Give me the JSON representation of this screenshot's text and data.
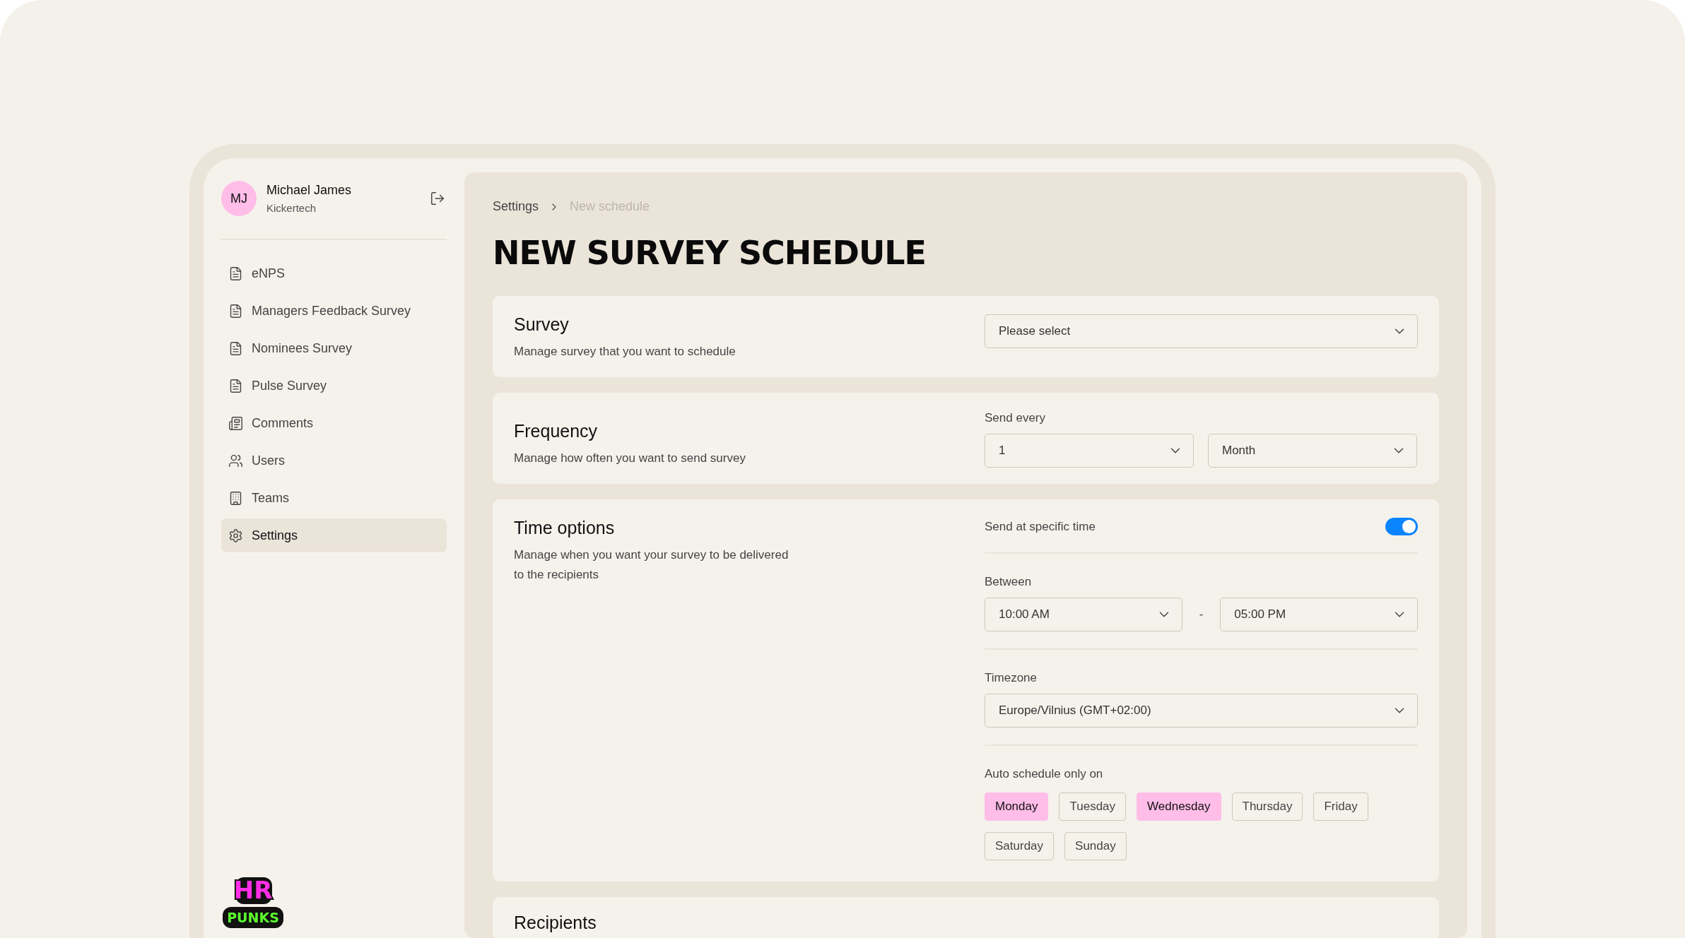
{
  "user": {
    "initials": "MJ",
    "name": "Michael James",
    "company": "Kickertech"
  },
  "nav": [
    {
      "label": "eNPS",
      "kind": "survey",
      "selected": false
    },
    {
      "label": "Managers Feedback Survey",
      "kind": "survey",
      "selected": false
    },
    {
      "label": "Nominees Survey",
      "kind": "survey",
      "selected": false
    },
    {
      "label": "Pulse Survey",
      "kind": "survey",
      "selected": false
    },
    {
      "label": "Comments",
      "kind": "comments",
      "selected": false
    },
    {
      "label": "Users",
      "kind": "users",
      "selected": false
    },
    {
      "label": "Teams",
      "kind": "teams",
      "selected": false
    },
    {
      "label": "Settings",
      "kind": "settings",
      "selected": true
    }
  ],
  "logo": {
    "line_1": "HR",
    "line_2": "PUNKS"
  },
  "breadcrumb": [
    {
      "label": "Settings",
      "current": false
    },
    {
      "label": "New schedule",
      "current": true
    }
  ],
  "title": "NEW SURVEY SCHEDULE",
  "survey_section": {
    "title": "Survey",
    "description": "Manage survey that you want to schedule",
    "select": {
      "placeholder": "Please select"
    }
  },
  "frequency_section": {
    "title": "Frequency",
    "description": "Manage how often you want to send survey",
    "label": "Send every",
    "count": "1",
    "unit": "Month"
  },
  "time_section": {
    "title": "Time options",
    "description": "Manage when you want your survey to be delivered to the recipients",
    "specific_time": {
      "label": "Send at specific time",
      "on": true
    },
    "between": {
      "label": "Between",
      "from": "10:00 AM",
      "separator": "-",
      "to": "05:00 PM"
    },
    "timezone": {
      "label": "Timezone",
      "value": "Europe/Vilnius (GMT+02:00)"
    },
    "days": {
      "label": "Auto schedule only on",
      "items": [
        {
          "label": "Monday",
          "selected": true
        },
        {
          "label": "Tuesday",
          "selected": false
        },
        {
          "label": "Wednesday",
          "selected": true
        },
        {
          "label": "Thursday",
          "selected": false
        },
        {
          "label": "Friday",
          "selected": false
        },
        {
          "label": "Saturday",
          "selected": false
        },
        {
          "label": "Sunday",
          "selected": false
        }
      ]
    }
  },
  "recipients_section": {
    "title": "Recipients"
  }
}
